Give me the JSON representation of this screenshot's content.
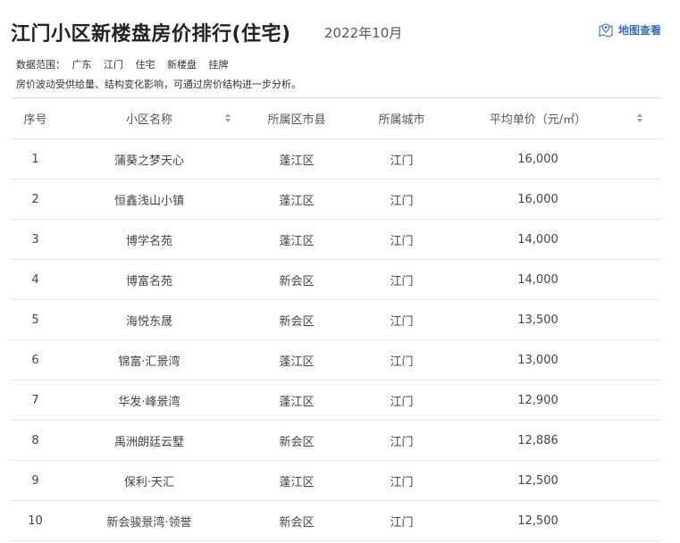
{
  "header": {
    "title": "江门小区新楼盘房价排行(住宅)",
    "date": "2022年10月",
    "map_link": "地图查看"
  },
  "scope": {
    "label": "数据范围：",
    "tags": [
      "广东",
      "江门",
      "住宅",
      "新楼盘",
      "挂牌"
    ]
  },
  "note": "房价波动受供给量、结构变化影响，可通过房价结构进一步分析。",
  "table": {
    "headers": {
      "rank": "序号",
      "name": "小区名称",
      "district": "所属区市县",
      "city": "所属城市",
      "price": "平均单价（元/㎡）"
    },
    "rows": [
      {
        "rank": "1",
        "name": "蒲葵之梦天心",
        "district": "蓬江区",
        "city": "江门",
        "price": "16,000"
      },
      {
        "rank": "2",
        "name": "恒鑫浅山小镇",
        "district": "蓬江区",
        "city": "江门",
        "price": "16,000"
      },
      {
        "rank": "3",
        "name": "博学名苑",
        "district": "蓬江区",
        "city": "江门",
        "price": "14,000"
      },
      {
        "rank": "4",
        "name": "博富名苑",
        "district": "新会区",
        "city": "江门",
        "price": "14,000"
      },
      {
        "rank": "5",
        "name": "海悦东晟",
        "district": "新会区",
        "city": "江门",
        "price": "13,500"
      },
      {
        "rank": "6",
        "name": "锦富·汇景湾",
        "district": "蓬江区",
        "city": "江门",
        "price": "13,000"
      },
      {
        "rank": "7",
        "name": "华发·峰景湾",
        "district": "蓬江区",
        "city": "江门",
        "price": "12,900"
      },
      {
        "rank": "8",
        "name": "禹洲朗廷云墅",
        "district": "新会区",
        "city": "江门",
        "price": "12,886"
      },
      {
        "rank": "9",
        "name": "保利·天汇",
        "district": "蓬江区",
        "city": "江门",
        "price": "12,500"
      },
      {
        "rank": "10",
        "name": "新会骏景湾·领誉",
        "district": "新会区",
        "city": "江门",
        "price": "12,500"
      }
    ]
  },
  "icons": {
    "map": "map-pin-icon",
    "sort": "sort-arrows-icon"
  },
  "colors": {
    "link": "#3a6fb0",
    "border": "#e2e2e2"
  }
}
